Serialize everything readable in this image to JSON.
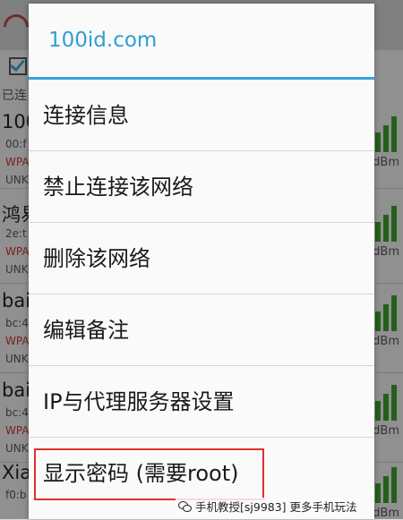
{
  "dialog": {
    "title": "100id.com",
    "accent_color": "#2e9fd3",
    "menu": [
      {
        "label": "连接信息"
      },
      {
        "label": "禁止连接该网络"
      },
      {
        "label": "删除该网络"
      },
      {
        "label": "编辑备注"
      },
      {
        "label": "IP与代理服务器设置"
      },
      {
        "label": "显示密码 (需要root)",
        "highlighted": true
      }
    ]
  },
  "background": {
    "status": "已连",
    "networks": [
      {
        "ssid": "100",
        "mac": "00:f",
        "security": "WPA",
        "extra": "UNK",
        "signal": "dBm"
      },
      {
        "ssid": "鸿易",
        "mac": "2e:t",
        "security": "WPA",
        "extra": "UNK",
        "signal": "dBm"
      },
      {
        "ssid": "bai",
        "mac": "bc:4",
        "security": "WPA",
        "extra": "UNK",
        "signal": "dBm"
      },
      {
        "ssid": "bai",
        "mac": "bc:4",
        "security": "WPA",
        "extra": "UNK",
        "signal": "dBm"
      },
      {
        "ssid": "Xia",
        "mac": "f0:b",
        "security": "",
        "extra": "",
        "signal": "dBm"
      }
    ]
  },
  "watermark": {
    "text": "手机教授[sj9983]  更多手机玩法",
    "icon": "wechat-icon"
  },
  "highlight_color": "#e0302e"
}
